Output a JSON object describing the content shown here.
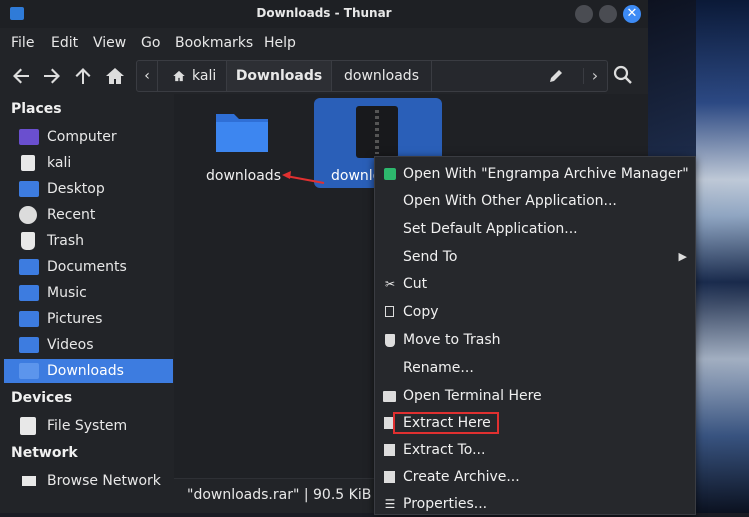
{
  "window": {
    "title": "Downloads - Thunar",
    "close_glyph": "✕"
  },
  "menubar": {
    "items": [
      "File",
      "Edit",
      "View",
      "Go",
      "Bookmarks",
      "Help"
    ]
  },
  "toolbar": {
    "back_icon": "arrow-left-icon",
    "forward_icon": "arrow-right-icon",
    "up_icon": "arrow-up-icon",
    "home_icon": "home-icon",
    "path": [
      "kali",
      "Downloads",
      "downloads"
    ],
    "edit_icon": "pencil-icon",
    "search_icon": "search-icon"
  },
  "sidebar": {
    "places_label": "Places",
    "places": [
      {
        "label": "Computer",
        "icon": "computer-icon"
      },
      {
        "label": "kali",
        "icon": "home-folder-icon"
      },
      {
        "label": "Desktop",
        "icon": "desktop-folder-icon"
      },
      {
        "label": "Recent",
        "icon": "recent-icon"
      },
      {
        "label": "Trash",
        "icon": "trash-icon"
      },
      {
        "label": "Documents",
        "icon": "documents-folder-icon"
      },
      {
        "label": "Music",
        "icon": "music-folder-icon"
      },
      {
        "label": "Pictures",
        "icon": "pictures-folder-icon"
      },
      {
        "label": "Videos",
        "icon": "videos-folder-icon"
      },
      {
        "label": "Downloads",
        "icon": "downloads-folder-icon"
      }
    ],
    "devices_label": "Devices",
    "devices": [
      {
        "label": "File System",
        "icon": "drive-icon"
      }
    ],
    "network_label": "Network",
    "network": [
      {
        "label": "Browse Network",
        "icon": "network-icon"
      }
    ]
  },
  "files": [
    {
      "name": "downloads",
      "icon": "folder-icon"
    },
    {
      "name": "downlo",
      "icon": "archive-icon",
      "selected": true
    }
  ],
  "status": {
    "text": "\"downloads.rar\" | 90.5 KiB (9"
  },
  "context_menu": {
    "items": [
      {
        "label": "Open With \"Engrampa Archive Manager\"",
        "icon": "engrampa-icon"
      },
      {
        "label": "Open With Other Application...",
        "icon": ""
      },
      {
        "label": "Set Default Application...",
        "icon": ""
      },
      {
        "label": "Send To",
        "icon": "",
        "submenu": "▶"
      },
      {
        "label": "Cut",
        "icon": "scissors-icon"
      },
      {
        "label": "Copy",
        "icon": "copy-icon"
      },
      {
        "label": "Move to Trash",
        "icon": "trash-icon"
      },
      {
        "label": "Rename...",
        "icon": ""
      },
      {
        "label": "Open Terminal Here",
        "icon": "terminal-icon"
      },
      {
        "label": "Extract Here",
        "icon": "archive-extract-icon"
      },
      {
        "label": "Extract To...",
        "icon": "archive-extract-icon"
      },
      {
        "label": "Create Archive...",
        "icon": "archive-create-icon"
      },
      {
        "label": "Properties...",
        "icon": "properties-icon"
      }
    ]
  }
}
